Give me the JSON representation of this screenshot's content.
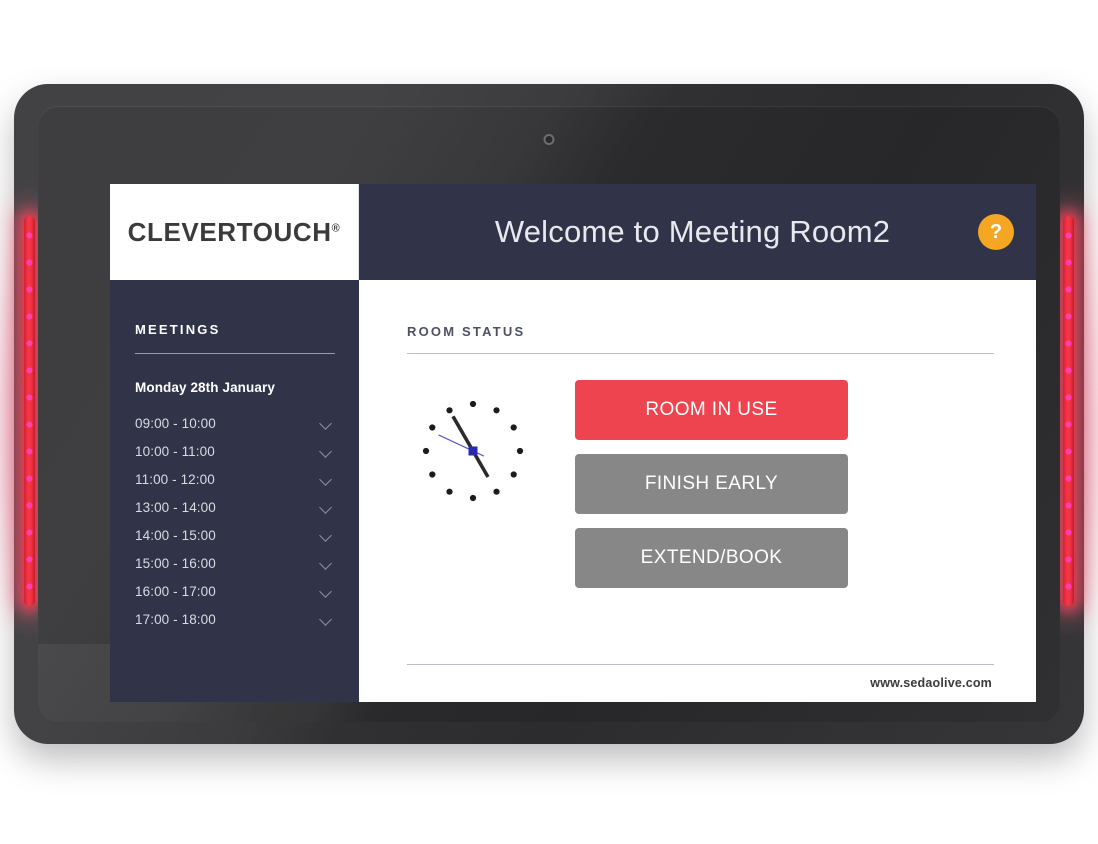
{
  "device": {
    "camera_icon": "camera-dot",
    "led_color": "#ee2f41",
    "led_glow_color": "#ffafc4"
  },
  "header": {
    "logo": "CLEVERTOUCH",
    "logo_mark": "®",
    "title": "Welcome to Meeting Room2",
    "help_label": "?",
    "help_icon": "question-mark-icon",
    "bar_color": "#313449"
  },
  "sidebar": {
    "heading": "MEETINGS",
    "date": "Monday 28th January",
    "slots": [
      {
        "label": "09:00 - 10:00",
        "chevron_icon": "chevron-down-icon"
      },
      {
        "label": "10:00 - 11:00",
        "chevron_icon": "chevron-down-icon"
      },
      {
        "label": "11:00 - 12:00",
        "chevron_icon": "chevron-down-icon"
      },
      {
        "label": "13:00 - 14:00",
        "chevron_icon": "chevron-down-icon"
      },
      {
        "label": "14:00 - 15:00",
        "chevron_icon": "chevron-down-icon"
      },
      {
        "label": "15:00 - 16:00",
        "chevron_icon": "chevron-down-icon"
      },
      {
        "label": "16:00 - 17:00",
        "chevron_icon": "chevron-down-icon"
      },
      {
        "label": "17:00 - 18:00",
        "chevron_icon": "chevron-down-icon"
      }
    ]
  },
  "main": {
    "heading": "ROOM STATUS",
    "clock": {
      "icon": "analog-clock-icon",
      "marker_count": 12,
      "marker_color": "#1c1c1c",
      "hand_color": "#2b2b2b",
      "second_hand_color": "#5b5bc8",
      "hub_color": "#2a2ab0",
      "hour_hand_angle_deg": 330,
      "minute_hand_angle_deg": 330,
      "second_hand_angle_deg": 295
    },
    "buttons": [
      {
        "label": "ROOM IN USE",
        "style": "red",
        "color": "#ee4450"
      },
      {
        "label": "FINISH EARLY",
        "style": "grey",
        "color": "#878787"
      },
      {
        "label": "EXTEND/BOOK",
        "style": "grey",
        "color": "#878787"
      }
    ]
  },
  "footer": {
    "url": "www.sedaolive.com"
  }
}
